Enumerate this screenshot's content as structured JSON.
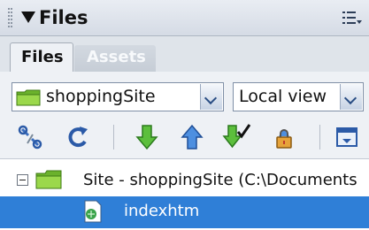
{
  "panel": {
    "title": "Files",
    "collapse_icon": "triangle-down-icon",
    "options_icon": "panel-options-icon"
  },
  "tabs": [
    {
      "label": "Files",
      "active": true
    },
    {
      "label": "Assets",
      "active": false
    }
  ],
  "site_select": {
    "value": "shoppingSite",
    "icon": "folder-icon"
  },
  "view_select": {
    "value": "Local view"
  },
  "toolbar": [
    {
      "name": "connect-icon",
      "tooltip": ""
    },
    {
      "name": "refresh-icon"
    },
    {
      "name": "get-files-icon"
    },
    {
      "name": "put-files-icon"
    },
    {
      "name": "check-out-icon"
    },
    {
      "name": "check-in-icon"
    },
    {
      "name": "expand-panel-icon"
    }
  ],
  "tree": {
    "root": {
      "label": "Site - shoppingSite (C:\\Documents",
      "expanded": true
    },
    "items": [
      {
        "label": "indexhtm",
        "selected": true
      }
    ]
  },
  "colors": {
    "selection": "#2f7fd7",
    "folder": "#8fcf3a",
    "arrow_green": "#3fa83a",
    "arrow_blue": "#3e7ed6"
  }
}
